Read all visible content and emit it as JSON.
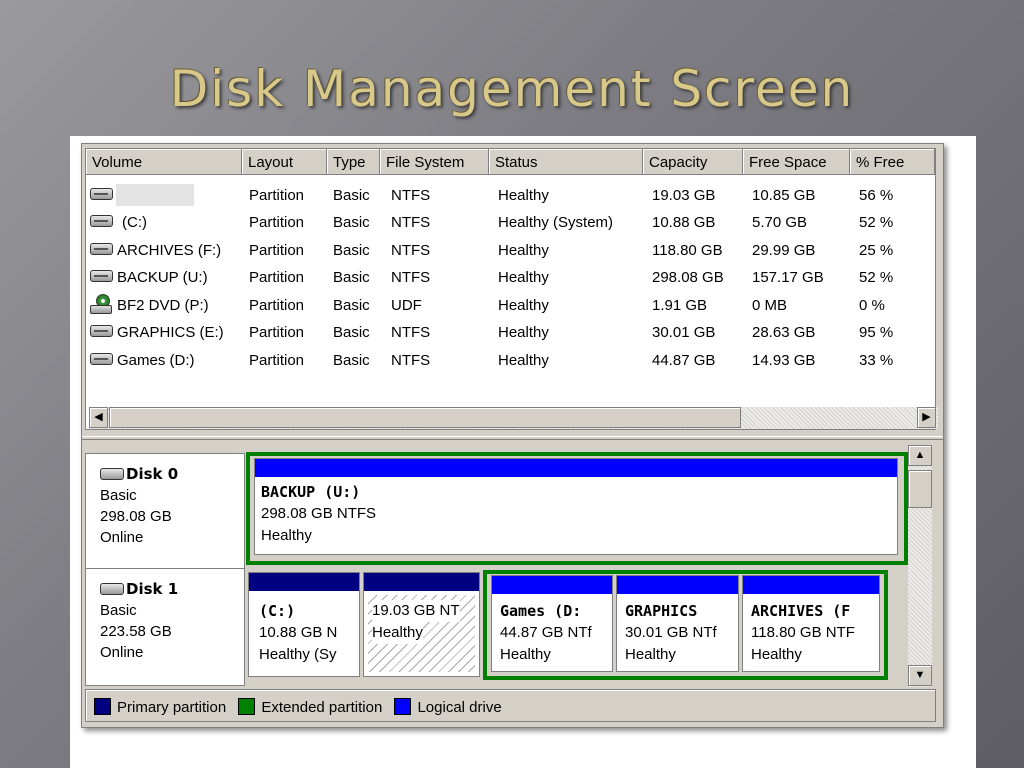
{
  "slide": {
    "title": "Disk Management Screen"
  },
  "columns": [
    "Volume",
    "Layout",
    "Type",
    "File System",
    "Status",
    "Capacity",
    "Free Space",
    "% Free"
  ],
  "volumes": [
    {
      "volume": "",
      "icon": "hard-drive-icon",
      "layout": "Partition",
      "type": "Basic",
      "fs": "NTFS",
      "status": "Healthy",
      "capacity": "19.03 GB",
      "free": "10.85 GB",
      "pct": "56 %"
    },
    {
      "volume": "(C:)",
      "icon": "hard-drive-icon",
      "layout": "Partition",
      "type": "Basic",
      "fs": "NTFS",
      "status": "Healthy (System)",
      "capacity": "10.88 GB",
      "free": "5.70 GB",
      "pct": "52 %"
    },
    {
      "volume": "ARCHIVES (F:)",
      "icon": "hard-drive-icon",
      "layout": "Partition",
      "type": "Basic",
      "fs": "NTFS",
      "status": "Healthy",
      "capacity": "118.80 GB",
      "free": "29.99 GB",
      "pct": "25 %"
    },
    {
      "volume": "BACKUP (U:)",
      "icon": "hard-drive-icon",
      "layout": "Partition",
      "type": "Basic",
      "fs": "NTFS",
      "status": "Healthy",
      "capacity": "298.08 GB",
      "free": "157.17 GB",
      "pct": "52 %"
    },
    {
      "volume": "BF2 DVD (P:)",
      "icon": "dvd-drive-icon",
      "layout": "Partition",
      "type": "Basic",
      "fs": "UDF",
      "status": "Healthy",
      "capacity": "1.91 GB",
      "free": "0 MB",
      "pct": "0 %"
    },
    {
      "volume": "GRAPHICS (E:)",
      "icon": "hard-drive-icon",
      "layout": "Partition",
      "type": "Basic",
      "fs": "NTFS",
      "status": "Healthy",
      "capacity": "30.01 GB",
      "free": "28.63 GB",
      "pct": "95 %"
    },
    {
      "volume": "Games (D:)",
      "icon": "hard-drive-icon",
      "layout": "Partition",
      "type": "Basic",
      "fs": "NTFS",
      "status": "Healthy",
      "capacity": "44.87 GB",
      "free": "14.93 GB",
      "pct": "33 %"
    }
  ],
  "disks": [
    {
      "title": "Disk 0",
      "kind": "Basic",
      "size": "298.08 GB",
      "state": "Online",
      "partitions": [
        {
          "name": "BACKUP (U:)",
          "detail": "298.08 GB NTFS",
          "status": "Healthy"
        }
      ]
    },
    {
      "title": "Disk 1",
      "kind": "Basic",
      "size": "223.58 GB",
      "state": "Online",
      "partitions": [
        {
          "name": "(C:)",
          "detail": "10.88 GB N",
          "status": "Healthy (Sy"
        },
        {
          "name": "",
          "detail": "19.03 GB NT",
          "status": "Healthy"
        },
        {
          "name": "Games (D:",
          "detail": "44.87 GB NTf",
          "status": "Healthy"
        },
        {
          "name": "GRAPHICS",
          "detail": "30.01 GB NTf",
          "status": "Healthy"
        },
        {
          "name": "ARCHIVES (F",
          "detail": "118.80 GB NTF",
          "status": "Healthy"
        }
      ]
    }
  ],
  "legend": [
    "Primary partition",
    "Extended partition",
    "Logical drive"
  ],
  "colors": {
    "primary": "#000080",
    "extended": "#008000",
    "logical": "#0000ff",
    "title": "#d8c98a"
  }
}
